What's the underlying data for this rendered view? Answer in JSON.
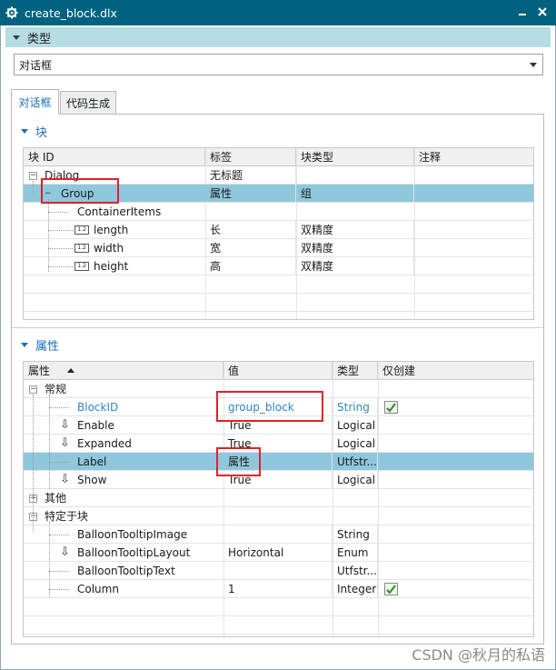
{
  "window": {
    "title": "create_block.dlx"
  },
  "type_section": {
    "label": "类型",
    "combo_value": "对话框"
  },
  "tabs": [
    {
      "label": "对话框"
    },
    {
      "label": "代码生成"
    }
  ],
  "block_group": {
    "label": "块",
    "columns": [
      "块 ID",
      "标签",
      "块类型",
      "注释"
    ],
    "rows": [
      {
        "id": "Dialog",
        "label": "无标题",
        "type": ""
      },
      {
        "id": "Group",
        "label": "属性",
        "type": "组"
      },
      {
        "id": "ContainerItems",
        "label": "",
        "type": ""
      },
      {
        "id": "length",
        "label": "长",
        "type": "双精度"
      },
      {
        "id": "width",
        "label": "宽",
        "type": "双精度"
      },
      {
        "id": "height",
        "label": "高",
        "type": "双精度"
      }
    ],
    "badge_text": "1.2"
  },
  "props_group": {
    "label": "属性",
    "columns": [
      "属性",
      "值",
      "类型",
      "仅创建"
    ],
    "categories": {
      "general": "常规",
      "other": "其他",
      "specific": "特定于块"
    },
    "general_rows": [
      {
        "name": "BlockID",
        "value": "group_block",
        "type": "String"
      },
      {
        "name": "Enable",
        "value": "True",
        "type": "Logical"
      },
      {
        "name": "Expanded",
        "value": "True",
        "type": "Logical"
      },
      {
        "name": "Label",
        "value": "属性",
        "type": "Utfstr..."
      },
      {
        "name": "Show",
        "value": "True",
        "type": "Logical"
      }
    ],
    "specific_rows": [
      {
        "name": "BalloonTooltipImage",
        "value": "",
        "type": "String"
      },
      {
        "name": "BalloonTooltipLayout",
        "value": "Horizontal",
        "type": "Enum"
      },
      {
        "name": "BalloonTooltipText",
        "value": "",
        "type": "Utfstr..."
      },
      {
        "name": "Column",
        "value": "1",
        "type": "Integer"
      }
    ]
  },
  "watermark": "CSDN @秋月的私语",
  "colors": {
    "titlebar": "#00627e",
    "section_header": "#b6dce6",
    "selected_row": "#8fc8dc",
    "highlight_box": "#e0212b",
    "link_blue": "#2f86c0"
  }
}
